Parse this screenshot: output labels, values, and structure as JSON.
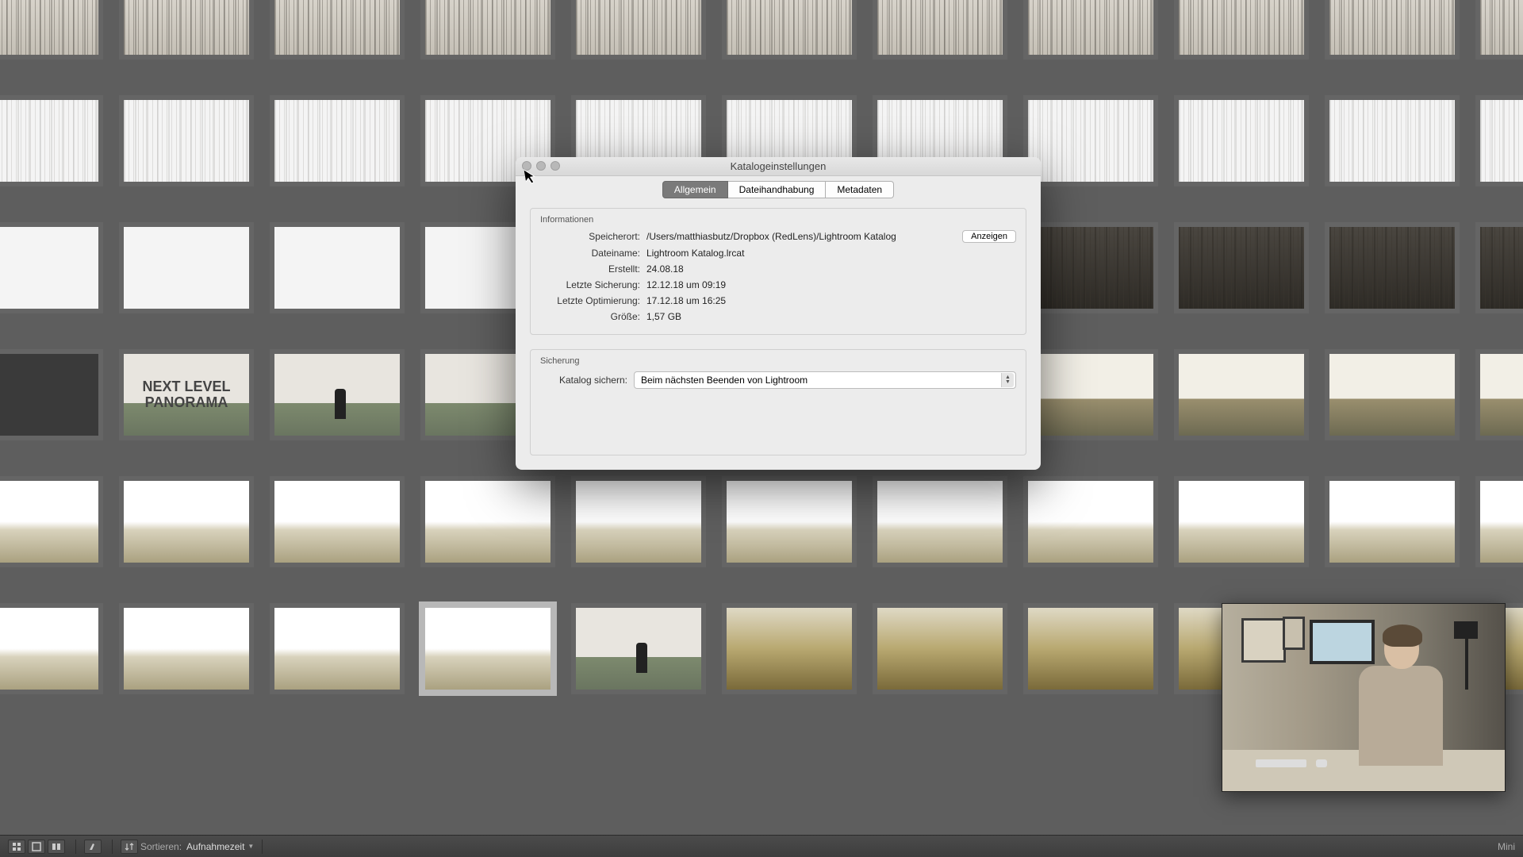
{
  "dialog": {
    "title": "Katalogeinstellungen",
    "tabs": {
      "allgemein": "Allgemein",
      "datei": "Dateihandhabung",
      "meta": "Metadaten"
    },
    "info_title": "Informationen",
    "labels": {
      "speicherort": "Speicherort:",
      "dateiname": "Dateiname:",
      "erstellt": "Erstellt:",
      "letzte_sicherung": "Letzte Sicherung:",
      "letzte_optimierung": "Letzte Optimierung:",
      "groesse": "Größe:"
    },
    "values": {
      "speicherort": "/Users/matthiasbutz/Dropbox (RedLens)/Lightroom Katalog",
      "dateiname": "Lightroom Katalog.lrcat",
      "erstellt": "24.08.18",
      "letzte_sicherung": "12.12.18 um 09:19",
      "letzte_optimierung": "17.12.18 um 16:25",
      "groesse": "1,57 GB"
    },
    "anzeigen": "Anzeigen",
    "sicherung_title": "Sicherung",
    "sichern_label": "Katalog sichern:",
    "sichern_value": "Beim nächsten Beenden von Lightroom"
  },
  "thumb_text": {
    "line1": "NEXT LEVEL",
    "line2": "PANORAMA"
  },
  "bar": {
    "sort_label": "Sortieren:",
    "sort_value": "Aufnahmezeit",
    "mini": "Mini"
  }
}
